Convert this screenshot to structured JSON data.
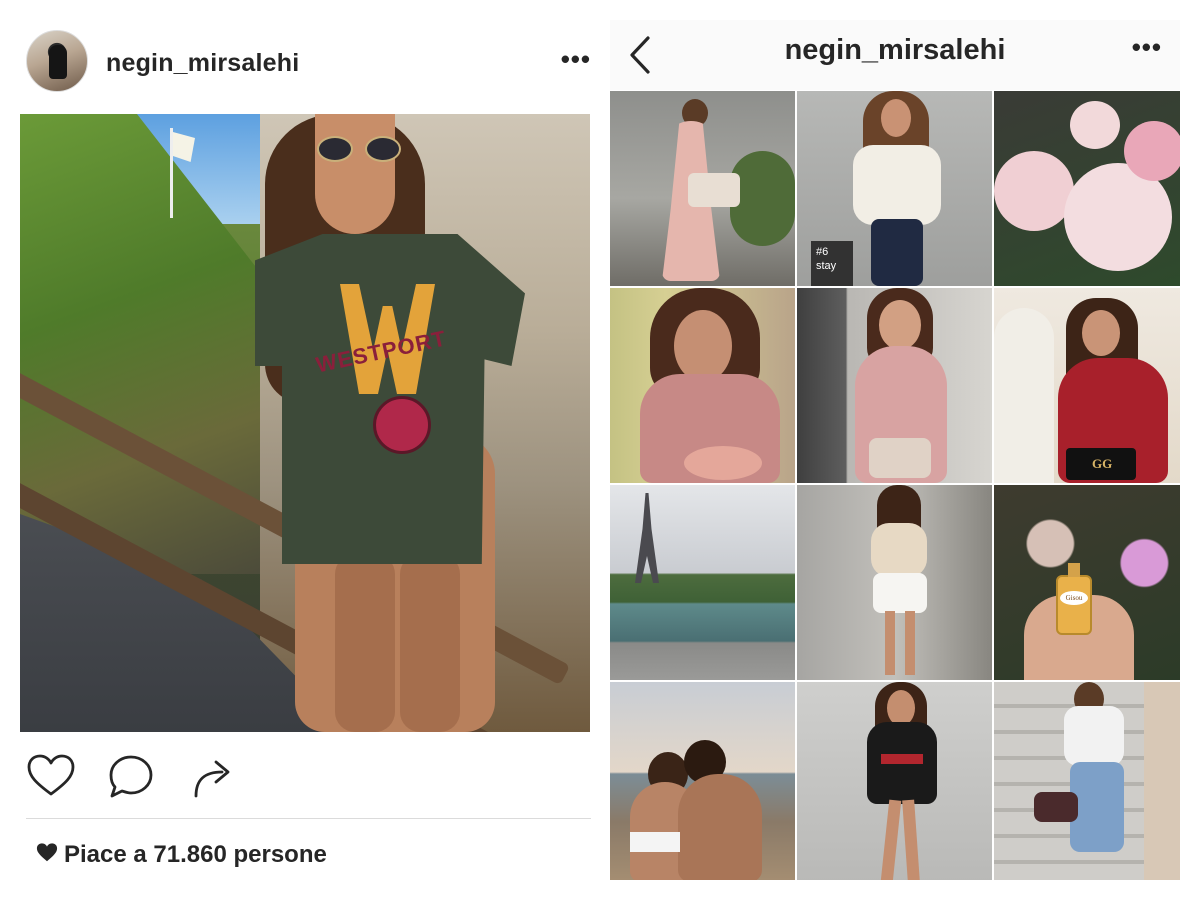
{
  "post": {
    "username": "negin_mirsalehi",
    "more": "•••",
    "image_alt": "Photo of woman in green Westport crop top and striped bikini bottoms on a cliffside path",
    "shirt_text": "WESTPORT",
    "actions": [
      {
        "icon": "heart-icon",
        "label": "like"
      },
      {
        "icon": "comment-icon",
        "label": "comment"
      },
      {
        "icon": "share-icon",
        "label": "share"
      }
    ],
    "likes_text": "Piace a 71.860 persone"
  },
  "profile": {
    "title": "negin_mirsalehi",
    "more": "•••",
    "back_icon": "chevron-left-icon",
    "grid": [
      {
        "name": "woman-pink-dress"
      },
      {
        "name": "woman-white-fur-vest",
        "tag_line1": "#6",
        "tag_line2": "stay"
      },
      {
        "name": "pink-roses"
      },
      {
        "name": "woman-pink-blouse-closeup"
      },
      {
        "name": "woman-pink-blouse-door"
      },
      {
        "name": "woman-red-blazer",
        "bag_logo": "GG"
      },
      {
        "name": "eiffel-tower-seine"
      },
      {
        "name": "woman-white-skirt-street"
      },
      {
        "name": "perfume-bottle-flowers",
        "bottle_label": "Gisou"
      },
      {
        "name": "couple-beach"
      },
      {
        "name": "woman-black-bodysuit"
      },
      {
        "name": "woman-stairs-jeans"
      }
    ]
  },
  "colors": {
    "text": "#262626",
    "divider": "#dbdbdb",
    "header_bg": "#fafafa"
  }
}
